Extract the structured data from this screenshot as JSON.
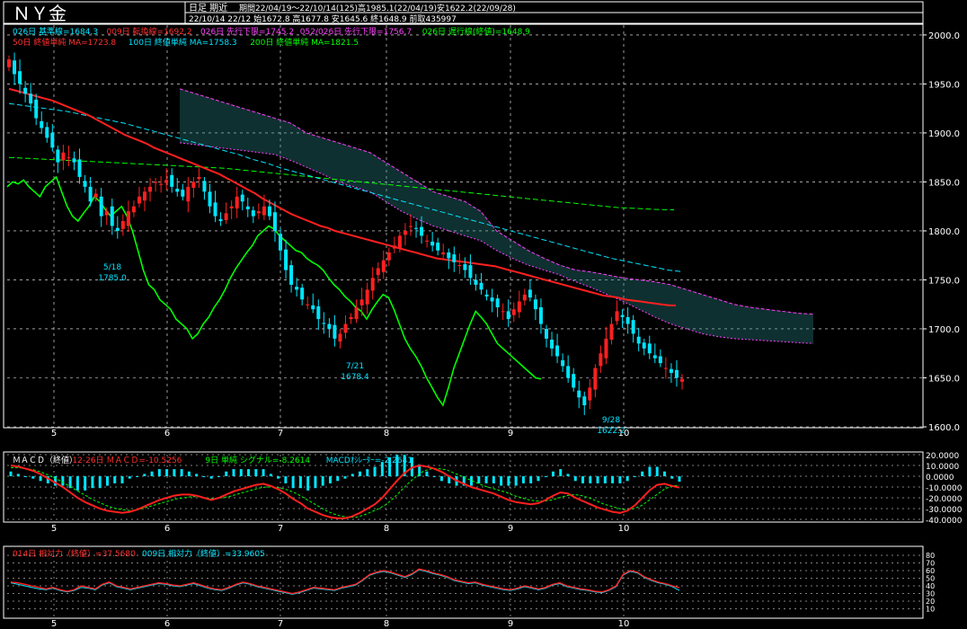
{
  "header": {
    "symbol": "ＮＹ金",
    "timeframe": "日足 期近",
    "period_info": "期間22/04/19～22/10/14(125)高1985.1(22/04/19)安1622.2(22/09/28)",
    "last_bar": "22/10/14 22/12 始1672.8 高1677.8 安1645.6 終1648.9 前取435997"
  },
  "legend": {
    "row1": [
      {
        "text": "026日 基準線=1684.3",
        "color": "#00e5ff"
      },
      {
        "text": "009日 転換線=1692.2",
        "color": "#ff3030"
      },
      {
        "text": "026日 先行下限=1745.2",
        "color": "#ff40ff"
      },
      {
        "text": "052/026日 先行下限=1756.7",
        "color": "#ff40ff"
      },
      {
        "text": "026日 遅行線(終値)=1648.9",
        "color": "#00ff00"
      }
    ],
    "row2": [
      {
        "text": "50日 終値単純 MA=1723.8",
        "color": "#ff3030"
      },
      {
        "text": "100日 終値単純 MA=1758.3",
        "color": "#00e5ff"
      },
      {
        "text": "200日 終値単純 MA=1821.5",
        "color": "#00ff00"
      }
    ]
  },
  "macd_legend": [
    {
      "text": "ＭＡＣＤ（終値）",
      "color": "#ffffff"
    },
    {
      "text": "12-26日 ＭＡＣＤ=-10.5256",
      "color": "#ff3030"
    },
    {
      "text": "9日 単純 シグナル=-8.2614",
      "color": "#00ff00"
    },
    {
      "text": "MACDｵｼﾚｰﾀｰ=-2.2641",
      "color": "#00e5ff"
    }
  ],
  "rsi_legend": [
    {
      "text": "014日 相対力（終値）=37.5680",
      "color": "#ff3030"
    },
    {
      "text": "009日 相対力（終値）=33.9605",
      "color": "#00e5ff"
    }
  ],
  "annotations": [
    {
      "label": "5/18",
      "value": "1785.0"
    },
    {
      "label": "7/21",
      "value": "1678.4"
    },
    {
      "label": "9/28",
      "value": "1622.2"
    }
  ],
  "colors": {
    "up": "#ff2020",
    "down": "#00e5ff",
    "grid": "#ffffff",
    "cloud": "#ff40ff",
    "ma50": "#ff2020",
    "ma100": "#00e5ff",
    "ma200": "#00ff00",
    "lag": "#00ff00"
  },
  "chart_data": [
    {
      "type": "candlestick",
      "title": "ＮＹ金",
      "x_tick_labels": [
        "5",
        "6",
        "7",
        "8",
        "9",
        "10"
      ],
      "y_tick_labels": [
        "2000.0",
        "1950.0",
        "1900.0",
        "1850.0",
        "1800.0",
        "1750.0",
        "1700.0",
        "1650.0",
        "1600.0"
      ],
      "ylim": [
        1600,
        2010
      ],
      "close": [
        1975,
        1960,
        1950,
        1940,
        1930,
        1915,
        1905,
        1895,
        1885,
        1870,
        1880,
        1875,
        1870,
        1855,
        1845,
        1830,
        1838,
        1815,
        1820,
        1805,
        1800,
        1810,
        1820,
        1825,
        1835,
        1840,
        1845,
        1850,
        1848,
        1852,
        1845,
        1840,
        1835,
        1845,
        1850,
        1855,
        1840,
        1825,
        1815,
        1810,
        1818,
        1825,
        1835,
        1830,
        1822,
        1815,
        1820,
        1825,
        1815,
        1800,
        1780,
        1760,
        1745,
        1740,
        1730,
        1725,
        1720,
        1710,
        1705,
        1700,
        1690,
        1695,
        1705,
        1712,
        1722,
        1730,
        1740,
        1752,
        1762,
        1770,
        1778,
        1785,
        1795,
        1800,
        1805,
        1802,
        1795,
        1790,
        1785,
        1780,
        1778,
        1772,
        1768,
        1765,
        1760,
        1752,
        1745,
        1740,
        1733,
        1728,
        1722,
        1718,
        1710,
        1720,
        1728,
        1735,
        1732,
        1720,
        1705,
        1690,
        1680,
        1672,
        1662,
        1650,
        1640,
        1630,
        1622,
        1640,
        1660,
        1675,
        1690,
        1705,
        1718,
        1712,
        1705,
        1695,
        1685,
        1680,
        1675,
        1670,
        1665,
        1660,
        1655,
        1650,
        1648.9
      ],
      "ma50": [
        1945,
        1943,
        1941,
        1939,
        1937,
        1935,
        1933,
        1930,
        1927,
        1924,
        1921,
        1918,
        1914,
        1910,
        1906,
        1902,
        1898,
        1895,
        1892,
        1889,
        1885,
        1882,
        1879,
        1876,
        1873,
        1870,
        1867,
        1864,
        1861,
        1858,
        1854,
        1850,
        1846,
        1842,
        1838,
        1833,
        1829,
        1825,
        1821,
        1817,
        1814,
        1811,
        1808,
        1805,
        1803,
        1800,
        1798,
        1796,
        1794,
        1792,
        1790,
        1788,
        1786,
        1784,
        1782,
        1780,
        1778,
        1776,
        1774,
        1772,
        1771,
        1770,
        1769,
        1768,
        1767,
        1766,
        1765,
        1764,
        1762,
        1760,
        1758,
        1756,
        1754,
        1752,
        1750,
        1748,
        1746,
        1744,
        1742,
        1740,
        1738,
        1736,
        1734,
        1733,
        1732,
        1730,
        1729,
        1728,
        1727,
        1726,
        1725,
        1724,
        1723.8
      ],
      "ma100": [
        1930,
        1928,
        1926,
        1924,
        1922,
        1919,
        1916,
        1913,
        1910,
        1906,
        1902,
        1898,
        1894,
        1890,
        1886,
        1882,
        1878,
        1873,
        1869,
        1864,
        1860,
        1856,
        1852,
        1848,
        1844,
        1840,
        1836,
        1832,
        1828,
        1824,
        1820,
        1816,
        1812,
        1808,
        1804,
        1800,
        1796,
        1792,
        1788,
        1784,
        1780,
        1776,
        1772,
        1769,
        1766,
        1763,
        1760,
        1758.3
      ],
      "ma200": [
        1875,
        1874,
        1873,
        1872,
        1871,
        1870,
        1869,
        1868,
        1867,
        1866,
        1865,
        1864,
        1862,
        1860,
        1858,
        1856,
        1854,
        1852,
        1850,
        1848,
        1846,
        1844,
        1842,
        1840,
        1838,
        1836,
        1834,
        1832,
        1830,
        1828,
        1826,
        1824,
        1823,
        1822,
        1821.5
      ],
      "cloud_upper": [
        1945,
        1940,
        1935,
        1930,
        1925,
        1920,
        1915,
        1910,
        1900,
        1895,
        1890,
        1885,
        1880,
        1870,
        1860,
        1850,
        1840,
        1835,
        1830,
        1820,
        1800,
        1790,
        1780,
        1772,
        1765,
        1760,
        1758,
        1755,
        1752,
        1750,
        1748,
        1745,
        1740,
        1735,
        1730,
        1725,
        1722,
        1720,
        1718,
        1716,
        1715
      ],
      "cloud_lower": [
        1890,
        1888,
        1886,
        1884,
        1882,
        1880,
        1878,
        1872,
        1865,
        1858,
        1850,
        1845,
        1840,
        1830,
        1820,
        1812,
        1805,
        1800,
        1795,
        1790,
        1780,
        1772,
        1765,
        1760,
        1755,
        1748,
        1742,
        1735,
        1728,
        1720,
        1712,
        1705,
        1700,
        1695,
        1692,
        1690,
        1689,
        1688,
        1687,
        1686,
        1685
      ]
    },
    {
      "type": "line",
      "title": "ＭＡＣＤ（終値）",
      "y_tick_labels": [
        "20.0000",
        "10.0000",
        "0.0000",
        "-10.0000",
        "-20.0000",
        "-30.0000",
        "-40.0000"
      ],
      "ylim": [
        -40,
        20
      ],
      "series": [
        {
          "name": "12-26日 ＭＡＣＤ",
          "values": [
            10,
            9,
            7,
            5,
            2,
            -2,
            -6,
            -10,
            -15,
            -20,
            -24,
            -27,
            -30,
            -32,
            -33,
            -34,
            -33,
            -31,
            -28,
            -25,
            -22,
            -20,
            -18,
            -17,
            -17,
            -18,
            -20,
            -22,
            -20,
            -17,
            -14,
            -12,
            -10,
            -8,
            -7,
            -9,
            -12,
            -16,
            -21,
            -25,
            -30,
            -33,
            -36,
            -38,
            -39,
            -39,
            -37,
            -34,
            -30,
            -26,
            -20,
            -12,
            -4,
            3,
            8,
            10,
            9,
            7,
            4,
            0,
            -4,
            -7,
            -10,
            -12,
            -14,
            -16,
            -19,
            -22,
            -24,
            -25,
            -26,
            -25,
            -22,
            -18,
            -15,
            -16,
            -20,
            -23,
            -26,
            -29,
            -31,
            -33,
            -34,
            -32,
            -27,
            -20,
            -13,
            -8,
            -7,
            -9,
            -10.5
          ]
        },
        {
          "name": "9日 単純 シグナル",
          "values": [
            8,
            8,
            7,
            6,
            4,
            1,
            -2,
            -6,
            -10,
            -14,
            -18,
            -22,
            -25,
            -28,
            -30,
            -31,
            -32,
            -31,
            -29,
            -27,
            -25,
            -23,
            -21,
            -20,
            -19,
            -19,
            -20,
            -21,
            -20,
            -19,
            -17,
            -15,
            -13,
            -11,
            -10,
            -10,
            -11,
            -13,
            -16,
            -20,
            -24,
            -28,
            -32,
            -35,
            -37,
            -38,
            -38,
            -36,
            -33,
            -30,
            -26,
            -20,
            -13,
            -6,
            0,
            5,
            7,
            7,
            6,
            3,
            0,
            -3,
            -6,
            -9,
            -11,
            -13,
            -15,
            -18,
            -20,
            -22,
            -23,
            -23,
            -22,
            -20,
            -18,
            -17,
            -18,
            -20,
            -23,
            -26,
            -28,
            -30,
            -31,
            -30,
            -27,
            -22,
            -17,
            -12,
            -9,
            -8.3
          ]
        },
        {
          "name": "MACDｵｼﾚｰﾀｰ",
          "values": [
            2,
            1,
            0,
            -1,
            -2,
            -3,
            -4,
            -4,
            -5,
            -6,
            -6,
            -5,
            -5,
            -4,
            -3,
            -3,
            -1,
            0,
            1,
            2,
            3,
            3,
            3,
            3,
            2,
            1,
            0,
            -1,
            0,
            2,
            3,
            3,
            3,
            3,
            3,
            1,
            -1,
            -3,
            -5,
            -5,
            -6,
            -5,
            -4,
            -3,
            -2,
            -1,
            1,
            2,
            3,
            4,
            6,
            8,
            9,
            9,
            8,
            5,
            2,
            0,
            -2,
            -3,
            -4,
            -4,
            -4,
            -3,
            -3,
            -3,
            -4,
            -4,
            -4,
            -3,
            -3,
            -2,
            0,
            2,
            3,
            1,
            -2,
            -3,
            -3,
            -3,
            -3,
            -3,
            -3,
            -2,
            0,
            2,
            4,
            4,
            2,
            -1,
            -2.3
          ]
        }
      ]
    },
    {
      "type": "line",
      "title": "相対力（終値）",
      "y_tick_labels": [
        "80",
        "70",
        "60",
        "50",
        "40",
        "30",
        "20",
        "10"
      ],
      "ylim": [
        0,
        80
      ],
      "series": [
        {
          "name": "014日 相対力（終値）",
          "values": [
            45,
            44,
            42,
            40,
            38,
            36,
            38,
            35,
            33,
            35,
            40,
            38,
            36,
            42,
            45,
            40,
            38,
            36,
            38,
            40,
            42,
            44,
            43,
            41,
            40,
            42,
            44,
            41,
            38,
            36,
            35,
            38,
            42,
            45,
            43,
            40,
            38,
            36,
            34,
            32,
            30,
            32,
            35,
            38,
            37,
            36,
            35,
            38,
            40,
            42,
            48,
            55,
            58,
            60,
            58,
            55,
            52,
            56,
            62,
            60,
            57,
            55,
            52,
            48,
            46,
            44,
            45,
            42,
            40,
            38,
            36,
            35,
            37,
            40,
            38,
            36,
            38,
            42,
            44,
            40,
            38,
            36,
            35,
            33,
            32,
            35,
            40,
            55,
            60,
            58,
            52,
            48,
            45,
            43,
            40,
            37.6
          ]
        },
        {
          "name": "009日 相対力（終値）",
          "values": [
            44,
            42,
            40,
            38,
            36,
            35,
            37,
            34,
            32,
            34,
            38,
            37,
            35,
            41,
            44,
            39,
            37,
            35,
            37,
            39,
            41,
            43,
            42,
            40,
            39,
            41,
            43,
            40,
            37,
            35,
            34,
            37,
            41,
            44,
            42,
            39,
            37,
            35,
            33,
            31,
            29,
            31,
            34,
            37,
            36,
            35,
            34,
            37,
            39,
            41,
            47,
            54,
            57,
            59,
            57,
            54,
            51,
            55,
            61,
            59,
            56,
            54,
            51,
            47,
            45,
            43,
            44,
            41,
            39,
            37,
            35,
            34,
            36,
            39,
            37,
            35,
            37,
            41,
            43,
            39,
            37,
            35,
            34,
            32,
            31,
            34,
            39,
            54,
            59,
            57,
            51,
            47,
            44,
            42,
            39,
            34.0
          ]
        }
      ]
    }
  ]
}
